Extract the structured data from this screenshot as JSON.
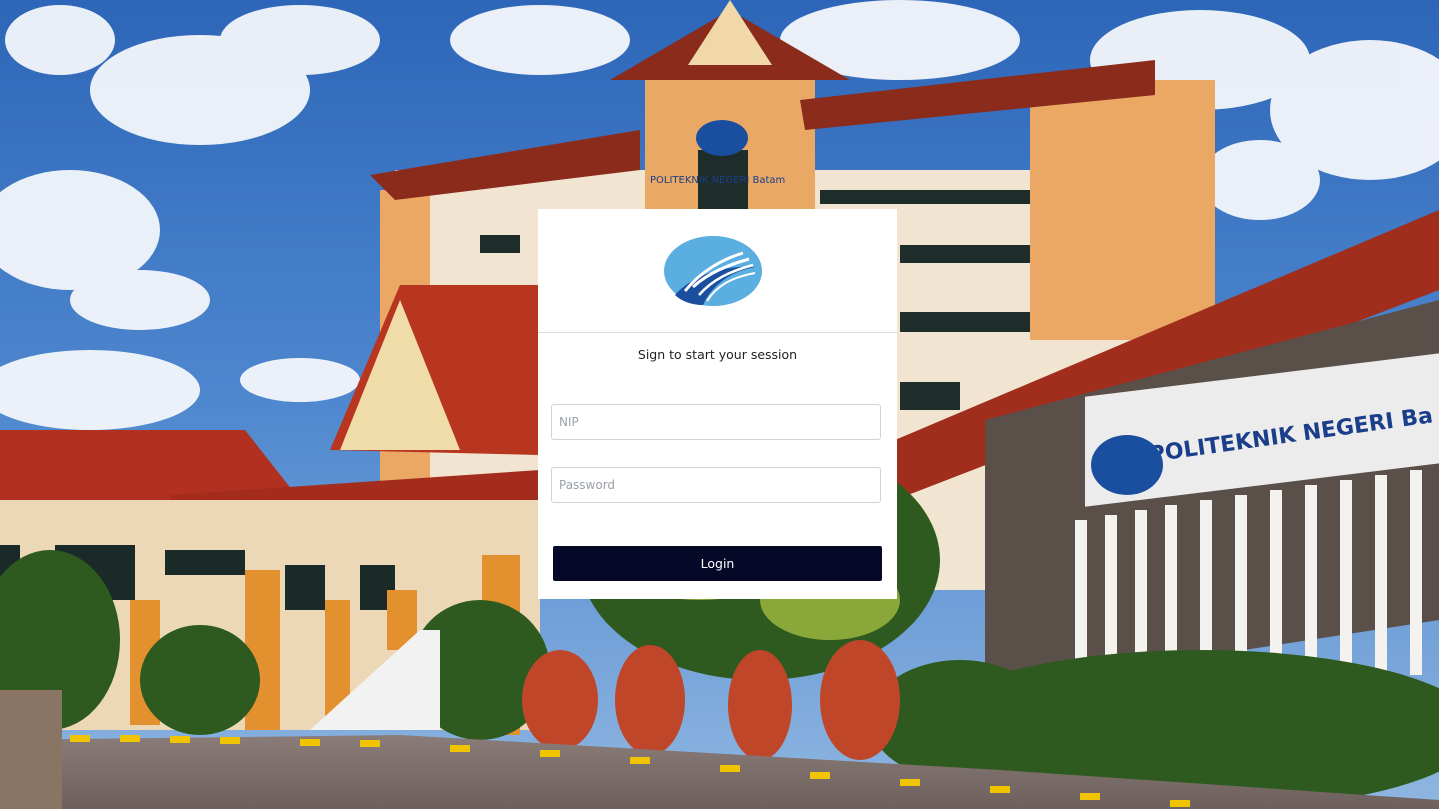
{
  "login": {
    "message": "Sign to start your session",
    "nip_placeholder": "NIP",
    "password_placeholder": "Password",
    "login_label": "Login"
  },
  "background": {
    "sign_text": "POLITEKNIK NEGERI Batam",
    "tower_text": "POLITEKNIK NEGERI Batam"
  },
  "colors": {
    "button": "#060828",
    "logo_blue": "#1a4fa0",
    "logo_light": "#5bb0e0"
  },
  "icons": {
    "logo": "politeknik-logo-icon"
  }
}
